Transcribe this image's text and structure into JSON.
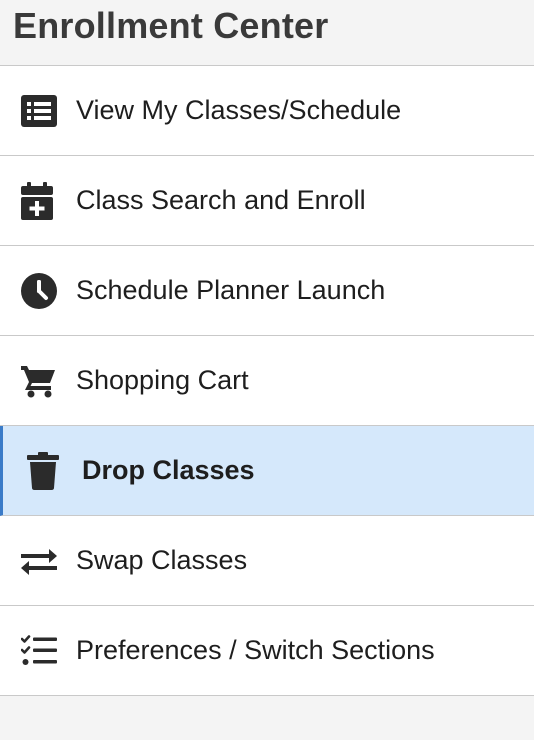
{
  "header": {
    "title": "Enrollment Center"
  },
  "nav": {
    "items": [
      {
        "label": "View My Classes/Schedule",
        "icon": "list-icon",
        "active": false
      },
      {
        "label": "Class Search and Enroll",
        "icon": "calendar-plus-icon",
        "active": false
      },
      {
        "label": "Schedule Planner Launch",
        "icon": "clock-icon",
        "active": false
      },
      {
        "label": "Shopping Cart",
        "icon": "shopping-cart-icon",
        "active": false
      },
      {
        "label": "Drop Classes",
        "icon": "trash-icon",
        "active": true
      },
      {
        "label": "Swap Classes",
        "icon": "swap-arrows-icon",
        "active": false
      },
      {
        "label": "Preferences / Switch Sections",
        "icon": "checklist-icon",
        "active": false
      }
    ]
  },
  "colors": {
    "background": "#f4f4f4",
    "item_background": "#ffffff",
    "active_background": "#d5e8fb",
    "active_border": "#3a7bc8",
    "icon": "#2b2b2b",
    "divider": "#c9c9c9"
  }
}
